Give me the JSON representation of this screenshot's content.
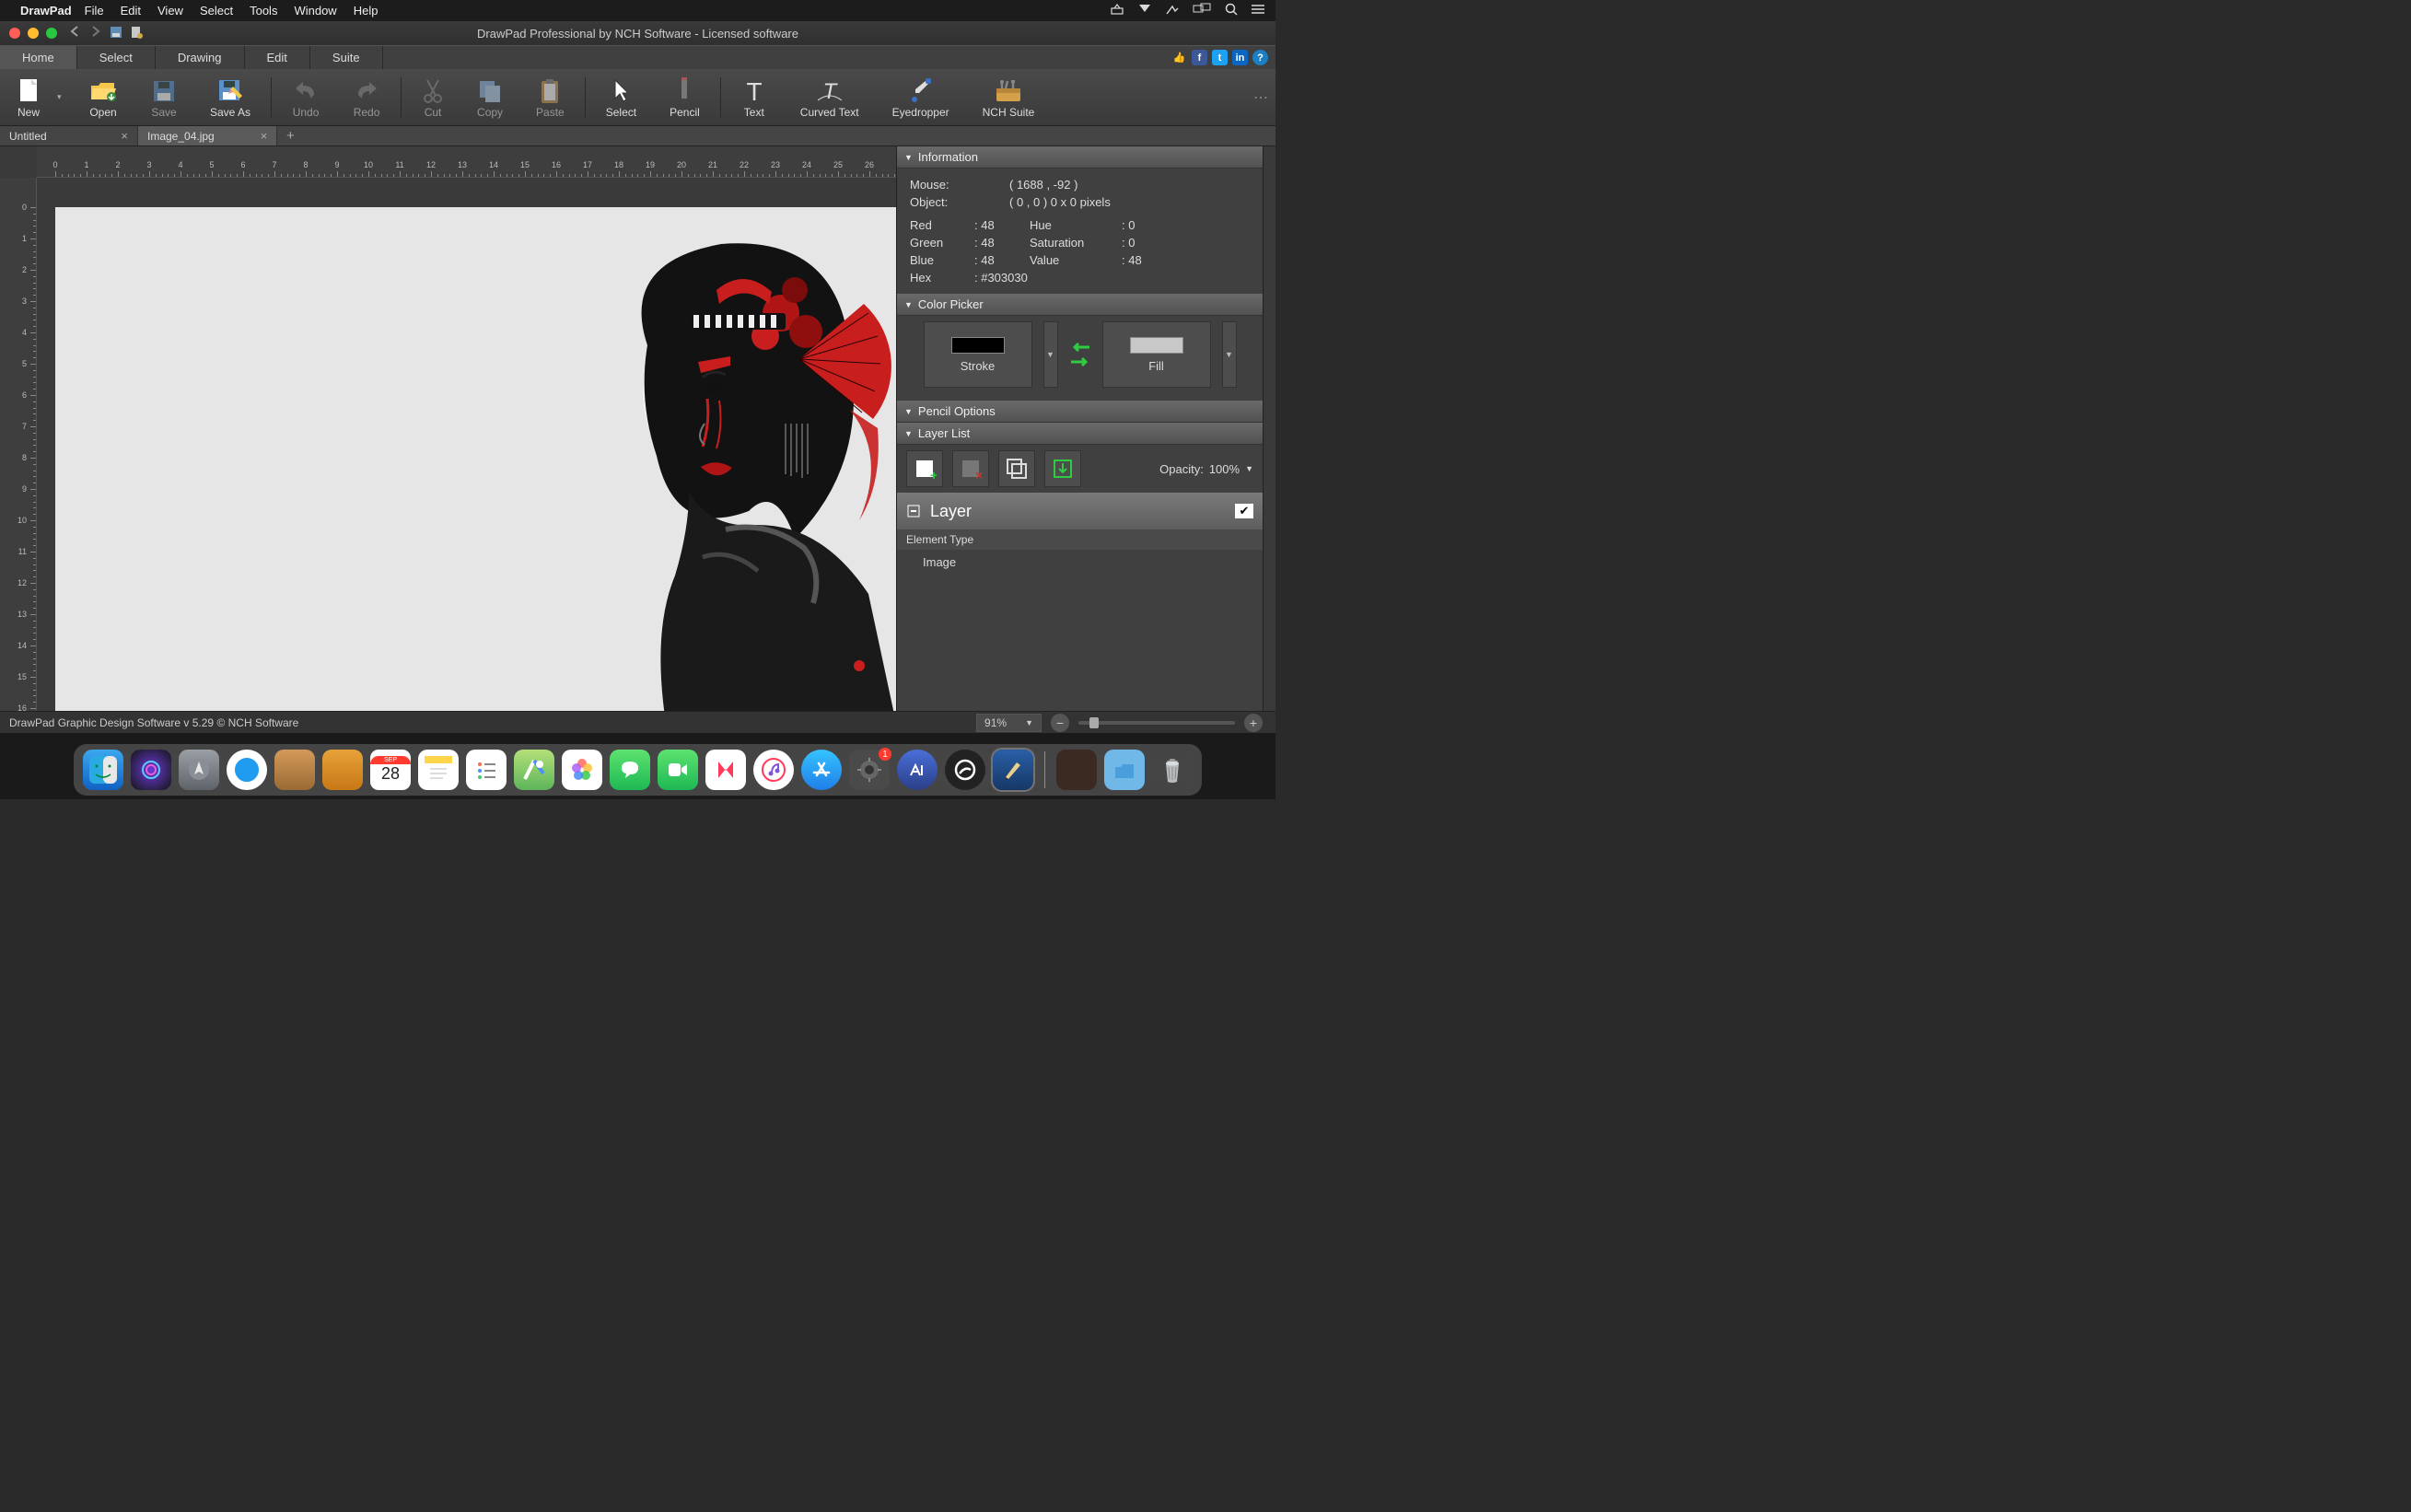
{
  "mac_menu": {
    "app": "DrawPad",
    "items": [
      "File",
      "Edit",
      "View",
      "Select",
      "Tools",
      "Window",
      "Help"
    ]
  },
  "titlebar": {
    "title": "DrawPad Professional by NCH Software - Licensed software"
  },
  "ribbon_tabs": [
    "Home",
    "Select",
    "Drawing",
    "Edit",
    "Suite"
  ],
  "ribbon_active": "Home",
  "toolbar": [
    {
      "id": "new",
      "label": "New",
      "kind": "doc-new"
    },
    {
      "id": "open",
      "label": "Open",
      "kind": "folder-open"
    },
    {
      "id": "save",
      "label": "Save",
      "kind": "floppy",
      "disabled": true
    },
    {
      "id": "saveas",
      "label": "Save As",
      "kind": "floppy-pencil"
    },
    {
      "sep": true
    },
    {
      "id": "undo",
      "label": "Undo",
      "kind": "undo",
      "disabled": true
    },
    {
      "id": "redo",
      "label": "Redo",
      "kind": "redo",
      "disabled": true
    },
    {
      "sep": true
    },
    {
      "id": "cut",
      "label": "Cut",
      "kind": "scissors",
      "disabled": true
    },
    {
      "id": "copy",
      "label": "Copy",
      "kind": "copy",
      "disabled": true
    },
    {
      "id": "paste",
      "label": "Paste",
      "kind": "clipboard",
      "disabled": true
    },
    {
      "sep": true
    },
    {
      "id": "select",
      "label": "Select",
      "kind": "cursor"
    },
    {
      "id": "pencil",
      "label": "Pencil",
      "kind": "pencil"
    },
    {
      "sep": true
    },
    {
      "id": "text",
      "label": "Text",
      "kind": "text"
    },
    {
      "id": "curvedtext",
      "label": "Curved Text",
      "kind": "curved-text"
    },
    {
      "id": "eyedropper",
      "label": "Eyedropper",
      "kind": "eyedropper"
    },
    {
      "id": "nchsuite",
      "label": "NCH Suite",
      "kind": "toolbox"
    }
  ],
  "doc_tabs": [
    {
      "label": "Untitled",
      "active": false
    },
    {
      "label": "Image_04.jpg",
      "active": true
    }
  ],
  "panels": {
    "information": {
      "title": "Information",
      "mouse_label": "Mouse:",
      "mouse_value": "( 1688 , -92 )",
      "object_label": "Object:",
      "object_value": "( 0 , 0 ) 0 x 0 pixels",
      "red_label": "Red",
      "red_value": ": 48",
      "green_label": "Green",
      "green_value": ": 48",
      "blue_label": "Blue",
      "blue_value": ": 48",
      "hex_label": "Hex",
      "hex_value": ": #303030",
      "hue_label": "Hue",
      "hue_value": ": 0",
      "sat_label": "Saturation",
      "sat_value": ": 0",
      "val_label": "Value",
      "val_value": ": 48"
    },
    "color_picker": {
      "title": "Color Picker",
      "stroke_label": "Stroke",
      "fill_label": "Fill",
      "stroke_color": "#000000",
      "fill_color": "#c8c8c8"
    },
    "pencil_options": {
      "title": "Pencil Options"
    },
    "layer_list": {
      "title": "Layer List",
      "opacity_label": "Opacity:",
      "opacity_value": "100%",
      "layer_name": "Layer",
      "element_type_header": "Element Type",
      "element_item": "Image"
    }
  },
  "statusbar": {
    "text": "DrawPad Graphic Design Software v 5.29 © NCH Software",
    "zoom": "91%"
  },
  "dock": {
    "date_month": "SEP",
    "date_day": "28"
  }
}
